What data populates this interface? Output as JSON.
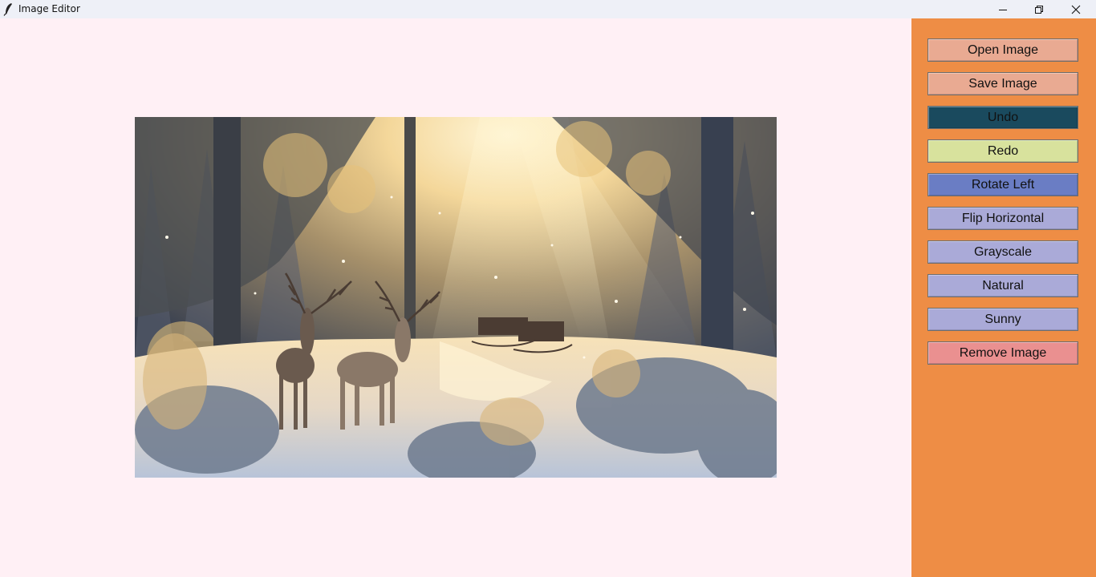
{
  "window": {
    "title": "Image Editor",
    "controls": [
      "minimize-icon",
      "restore-icon",
      "close-icon"
    ]
  },
  "canvas": {
    "background": "#fff0f5",
    "image_description_icon": "winter-forest-deer-photo"
  },
  "sidebar": {
    "background": "#ee8d45",
    "buttons": [
      {
        "label": "Open Image",
        "color": "#e9aa92"
      },
      {
        "label": "Save Image",
        "color": "#e9aa92"
      },
      {
        "label": "Undo",
        "color": "#1a4a5e"
      },
      {
        "label": "Redo",
        "color": "#d8e29d"
      },
      {
        "label": "Rotate Left",
        "color": "#6a7dc4"
      },
      {
        "label": "Flip Horizontal",
        "color": "#aaaad8"
      },
      {
        "label": "Grayscale",
        "color": "#aaaad8"
      },
      {
        "label": "Natural",
        "color": "#aaaad8"
      },
      {
        "label": "Sunny",
        "color": "#aaaad8"
      },
      {
        "label": "Remove Image",
        "color": "#ea9090"
      }
    ]
  }
}
